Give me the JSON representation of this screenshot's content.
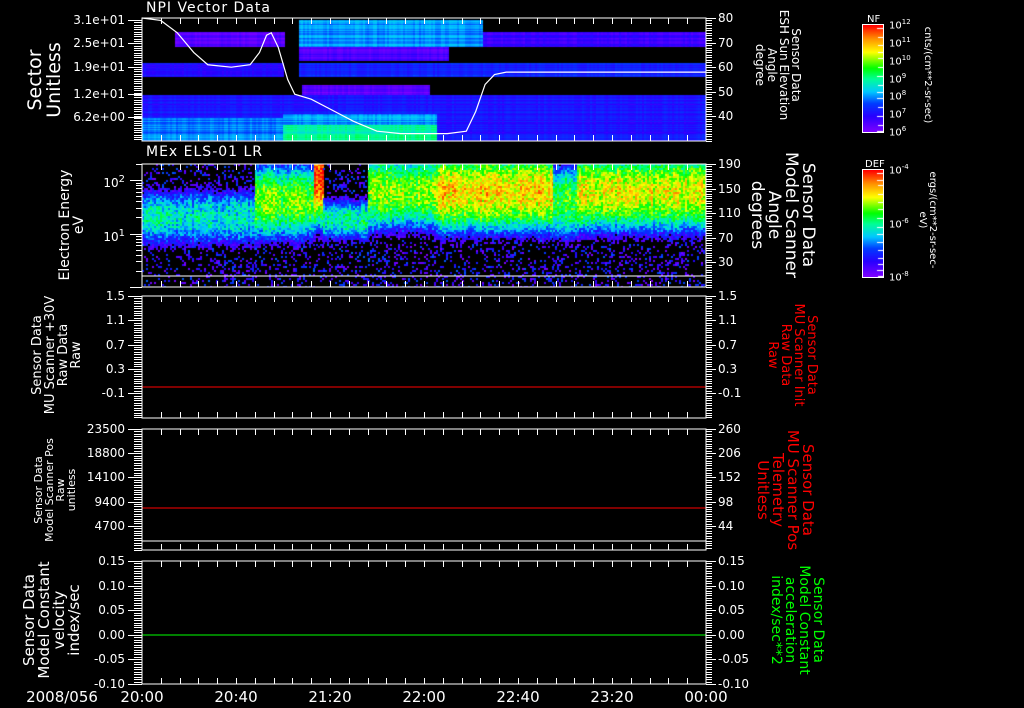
{
  "colors": {
    "axes": "#ffffff",
    "background": "#000000",
    "series_red": "#ff0000",
    "series_green": "#00ff00",
    "series_white": "#ffffff"
  },
  "x_axis": {
    "date": "2008/056",
    "ticks": [
      "20:00",
      "20:40",
      "21:20",
      "22:00",
      "22:40",
      "23:20",
      "00:00"
    ],
    "range": [
      "20:00",
      "00:00"
    ]
  },
  "chart_data": [
    {
      "type": "heatmap",
      "title": "NPI Vector Data",
      "ylabel": "Sector\nUnitless",
      "ylim": [
        0,
        31.5
      ],
      "yticks": [
        31,
        25,
        19,
        12,
        6.2
      ],
      "yticklabels": [
        "3.1e+01",
        "2.5e+01",
        "1.9e+01",
        "1.2e+01",
        "6.2e+00"
      ],
      "y2label": "Sensor Data\nESH Sun Elevation\nAngle\ndegree",
      "y2lim": [
        30,
        80
      ],
      "y2ticks": [
        80,
        70,
        60,
        50,
        40
      ],
      "colorbar": {
        "label": "NF",
        "units": "cnts/(cm**2-sr-sec)",
        "log10_range": [
          6,
          12
        ],
        "ticks": [
          {
            "b": "10",
            "e": "12"
          },
          {
            "b": "10",
            "e": "11"
          },
          {
            "b": "10",
            "e": "10"
          },
          {
            "b": "10",
            "e": "9"
          },
          {
            "b": "10",
            "e": "8"
          },
          {
            "b": "10",
            "e": "7"
          },
          {
            "b": "10",
            "e": "6"
          }
        ]
      },
      "regions": [
        {
          "t": [
            "20:14",
            "21:01"
          ],
          "s": [
            24,
            28
          ],
          "log10": 6.4
        },
        {
          "t": [
            "21:07",
            "22:25"
          ],
          "s": [
            24,
            31
          ],
          "log10": 8.0
        },
        {
          "t": [
            "22:25",
            "00:00"
          ],
          "s": [
            24,
            28
          ],
          "log10": 6.7
        },
        {
          "t": [
            "21:07",
            "22:10"
          ],
          "s": [
            20.5,
            24
          ],
          "log10": 6.5
        },
        {
          "t": [
            "20:00",
            "21:00"
          ],
          "s": [
            16.5,
            20
          ],
          "log10": 7.0
        },
        {
          "t": [
            "21:07",
            "00:00"
          ],
          "s": [
            16.5,
            20
          ],
          "log10": 7.3
        },
        {
          "t": [
            "21:08",
            "22:02"
          ],
          "s": [
            11.8,
            14.4
          ],
          "log10": 6.4
        },
        {
          "t": [
            "20:00",
            "00:00"
          ],
          "s": [
            0,
            11.8
          ],
          "log10": 7.1
        },
        {
          "t": [
            "20:00",
            "21:00"
          ],
          "s": [
            0,
            6
          ],
          "log10": 7.9
        },
        {
          "t": [
            "21:00",
            "22:05"
          ],
          "s": [
            4,
            7
          ],
          "log10": 8.1
        },
        {
          "t": [
            "21:00",
            "22:05"
          ],
          "s": [
            0,
            4
          ],
          "log10": 8.9
        }
      ],
      "line_y2": {
        "color": "#ffffff",
        "points": [
          [
            "20:00",
            80
          ],
          [
            "20:08",
            79
          ],
          [
            "20:15",
            74
          ],
          [
            "20:22",
            66
          ],
          [
            "20:28",
            61
          ],
          [
            "20:38",
            60
          ],
          [
            "20:46",
            61
          ],
          [
            "20:50",
            66
          ],
          [
            "20:53",
            73
          ],
          [
            "20:55",
            74
          ],
          [
            "20:58",
            68
          ],
          [
            "21:02",
            55
          ],
          [
            "21:05",
            49
          ],
          [
            "21:12",
            47
          ],
          [
            "21:20",
            43
          ],
          [
            "21:30",
            38
          ],
          [
            "21:40",
            34
          ],
          [
            "21:50",
            33
          ],
          [
            "22:10",
            33
          ],
          [
            "22:18",
            34
          ],
          [
            "22:22",
            42
          ],
          [
            "22:26",
            53
          ],
          [
            "22:30",
            57
          ],
          [
            "22:35",
            58
          ],
          [
            "00:00",
            58
          ]
        ]
      }
    },
    {
      "type": "heatmap",
      "title": "MEx ELS-01 LR",
      "ylabel": "Electron Energy\neV",
      "yscale": "log",
      "ylim": [
        1,
        200
      ],
      "yticks": [
        100,
        10
      ],
      "yticklabels": [
        {
          "b": "10",
          "e": "2"
        },
        {
          "b": "10",
          "e": "1"
        }
      ],
      "y2label": "Sensor Data\nModel Scanner\nAngle\ndegrees",
      "y2lim": [
        -10,
        190
      ],
      "y2ticks": [
        190,
        150,
        110,
        70,
        30
      ],
      "lower_line_ev": 1.6,
      "colorbar": {
        "label": "DEF",
        "units": "ergs/(cm**2-sr-sec-eV)",
        "log10_range": [
          -8,
          -4
        ],
        "ticks": [
          {
            "b": "10",
            "e": "-4"
          },
          {
            "b": "10",
            "e": "-6"
          },
          {
            "b": "10",
            "e": "-8"
          }
        ]
      },
      "segments": [
        {
          "t": [
            "20:00",
            "20:48"
          ],
          "peak_ev": 20,
          "log10": -6.2,
          "width": 0.5
        },
        {
          "t": [
            "20:48",
            "21:13"
          ],
          "peak_ev": 40,
          "log10": -5.4,
          "width": 0.6
        },
        {
          "t": [
            "21:13",
            "21:17"
          ],
          "peak_ev": 120,
          "log10": -4.2,
          "width": 0.7
        },
        {
          "t": [
            "21:17",
            "21:36"
          ],
          "peak_ev": 18,
          "log10": -6.0,
          "width": 0.35
        },
        {
          "t": [
            "21:36",
            "22:05"
          ],
          "peak_ev": 60,
          "log10": -5.3,
          "width": 0.6
        },
        {
          "t": [
            "22:05",
            "22:55"
          ],
          "peak_ev": 60,
          "log10": -4.8,
          "width": 0.6
        },
        {
          "t": [
            "22:55",
            "23:05"
          ],
          "peak_ev": 40,
          "log10": -5.6,
          "width": 0.6
        },
        {
          "t": [
            "23:05",
            "00:00"
          ],
          "peak_ev": 60,
          "log10": -5.0,
          "width": 0.6
        }
      ]
    },
    {
      "type": "line",
      "ylabel": "Sensor Data\nMU Scanner +30V\nRaw Data\nRaw",
      "ylim": [
        -0.51,
        1.5
      ],
      "yticks": [
        1.5,
        1.1,
        0.7,
        0.3,
        -0.1
      ],
      "yticklabels": [
        "1.5",
        "1.1",
        "0.7",
        "0.3",
        "-0.1"
      ],
      "y2label": "Sensor Data\nMU Scanner Init\nRaw Data\nRaw",
      "y2lim": [
        -0.51,
        1.5
      ],
      "y2ticks": [
        1.5,
        1.1,
        0.7,
        0.3,
        -0.1
      ],
      "y2ticklabels": [
        "1.5",
        "1.1",
        "0.7",
        "0.3",
        "-0.1"
      ],
      "series": [
        {
          "axis": "y2",
          "color": "#ff0000",
          "x": [
            "20:00",
            "00:00"
          ],
          "y": [
            0,
            0
          ]
        }
      ]
    },
    {
      "type": "line",
      "ylabel": "Sensor Data\nModel Scanner Pos\nRaw\nunitless",
      "ylim": [
        0,
        23500
      ],
      "yticks": [
        23500,
        18800,
        14100,
        9400,
        4700
      ],
      "yticklabels": [
        "23500",
        "18800",
        "14100",
        "9400",
        "4700"
      ],
      "y2label": "Sensor Data\nMU Scanner Pos\nTelemetry\nUnitless",
      "y2lim": [
        -9.5,
        260
      ],
      "y2ticks": [
        260,
        206,
        152,
        98,
        44
      ],
      "y2ticklabels": [
        "260",
        "206",
        "152",
        "98",
        "44"
      ],
      "series": [
        {
          "axis": "y2",
          "color": "#ff0000",
          "x": [
            "20:00",
            "00:00"
          ],
          "y": [
            84,
            84
          ]
        }
      ]
    },
    {
      "type": "line",
      "ylabel": "Sensor Data\nModel Constant\nvelocity\nindex/sec",
      "ylim": [
        -0.1,
        0.15
      ],
      "yticks": [
        0.15,
        0.1,
        0.05,
        0.0,
        -0.05,
        -0.1
      ],
      "yticklabels": [
        "0.15",
        "0.10",
        "0.05",
        "0.00",
        "-0.05",
        "-0.10"
      ],
      "y2label": "Sensor Data\nModel Constant\nacceleration\nindex/sec**2",
      "y2lim": [
        -0.1,
        0.15
      ],
      "y2ticks": [
        0.15,
        0.1,
        0.05,
        0.0,
        -0.05,
        -0.1
      ],
      "y2ticklabels": [
        "0.15",
        "0.10",
        "0.05",
        "0.00",
        "-0.05",
        "-0.10"
      ],
      "series": [
        {
          "axis": "y2",
          "color": "#00ff00",
          "x": [
            "20:00",
            "00:00"
          ],
          "y": [
            0,
            0
          ]
        }
      ]
    }
  ]
}
